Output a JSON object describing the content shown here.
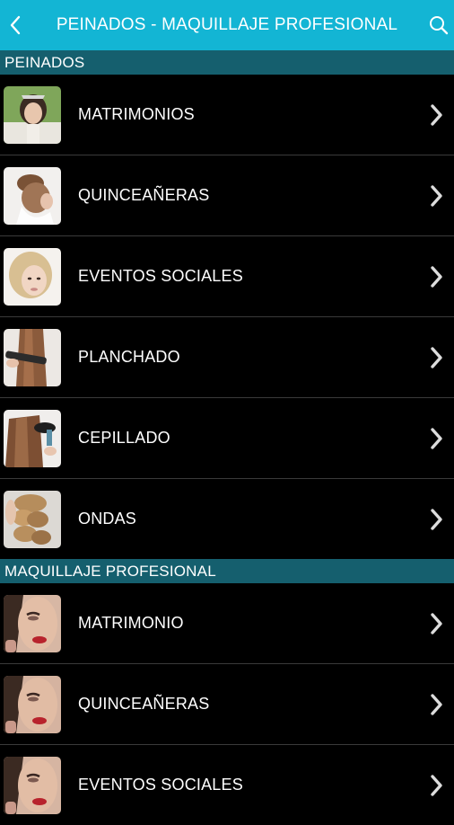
{
  "header": {
    "title": "PEINADOS - MAQUILLAJE PROFESIONAL",
    "back_icon": "chevron-left-icon",
    "search_icon": "search-icon"
  },
  "sections": [
    {
      "title": "PEINADOS",
      "items": [
        {
          "label": "MATRIMONIOS"
        },
        {
          "label": "QUINCEAÑERAS"
        },
        {
          "label": "EVENTOS SOCIALES"
        },
        {
          "label": "PLANCHADO"
        },
        {
          "label": "CEPILLADO"
        },
        {
          "label": "ONDAS"
        }
      ]
    },
    {
      "title": "MAQUILLAJE PROFESIONAL",
      "items": [
        {
          "label": "MATRIMONIO"
        },
        {
          "label": "QUINCEAÑERAS"
        },
        {
          "label": "EVENTOS SOCIALES"
        }
      ]
    }
  ],
  "colors": {
    "accent": "#13b5d4",
    "section_header": "#155f6e",
    "background": "#000000",
    "divider": "#3a3a3a"
  }
}
